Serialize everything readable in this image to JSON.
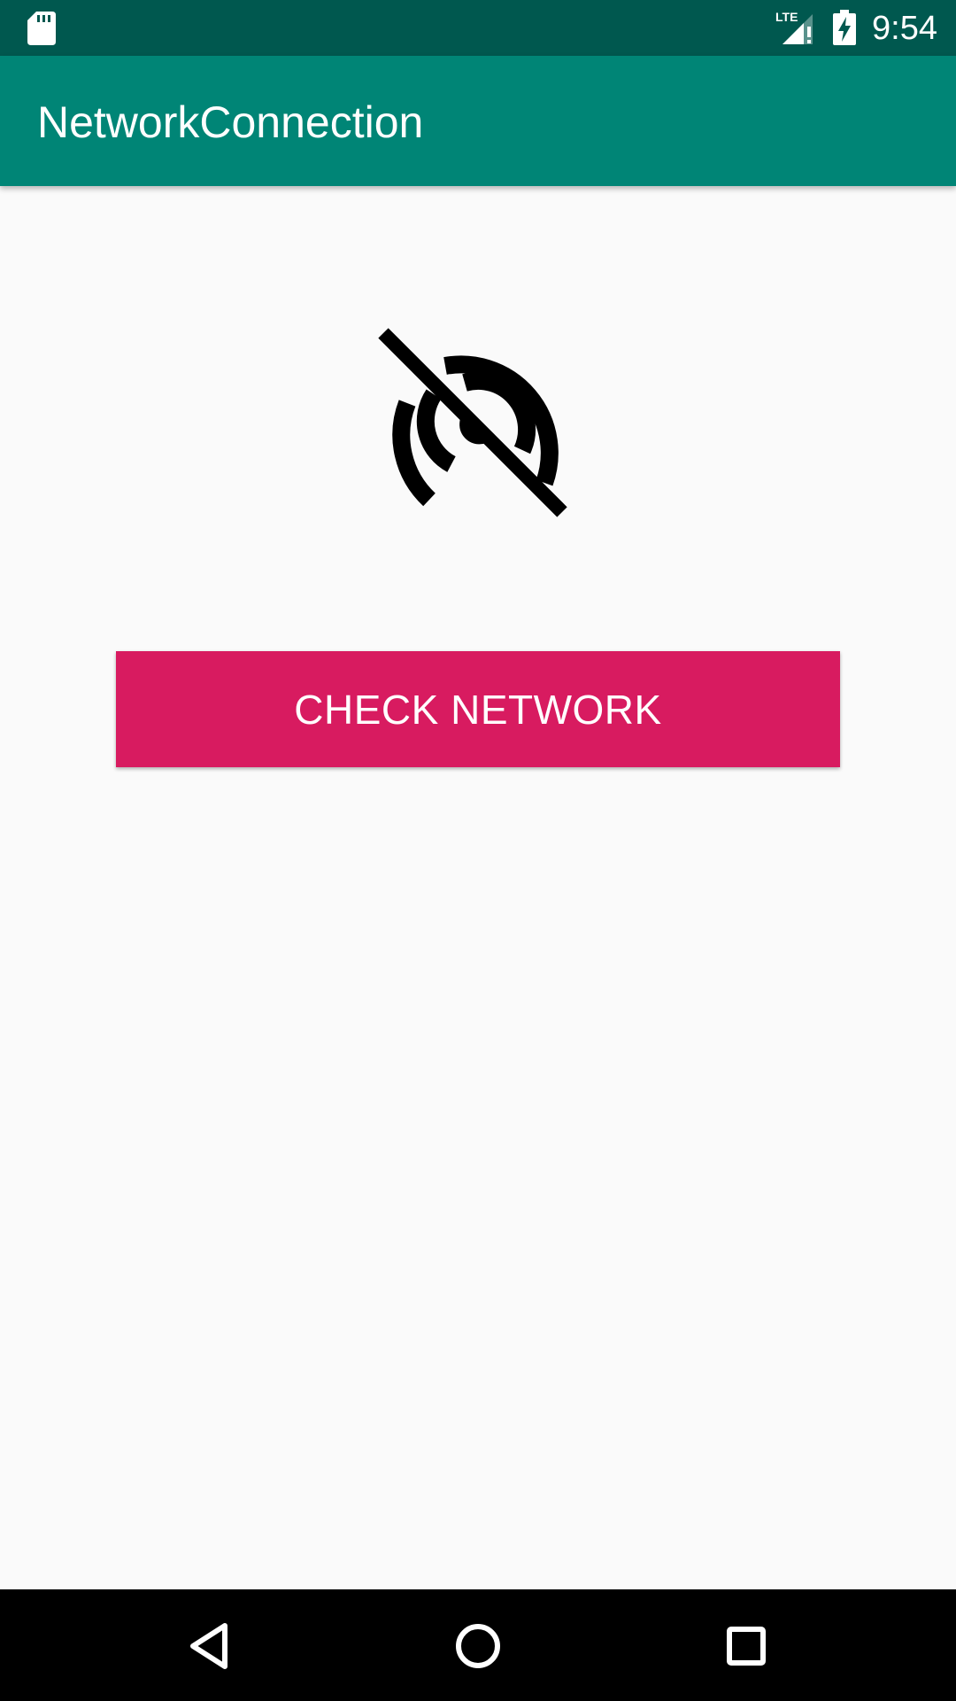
{
  "status_bar": {
    "time": "9:54",
    "icons": [
      "sd-card-icon",
      "lte-signal-icon",
      "battery-charging-icon"
    ],
    "background": "#00584f"
  },
  "app_bar": {
    "title": "NetworkConnection",
    "background": "#008576"
  },
  "main": {
    "status_icon": "network-off-icon",
    "check_button_label": "CHECK NETWORK",
    "button_color": "#d81b60",
    "background": "#fafafa"
  },
  "nav_bar": {
    "buttons": [
      "back-icon",
      "home-icon",
      "recents-icon"
    ],
    "background": "#000000"
  }
}
